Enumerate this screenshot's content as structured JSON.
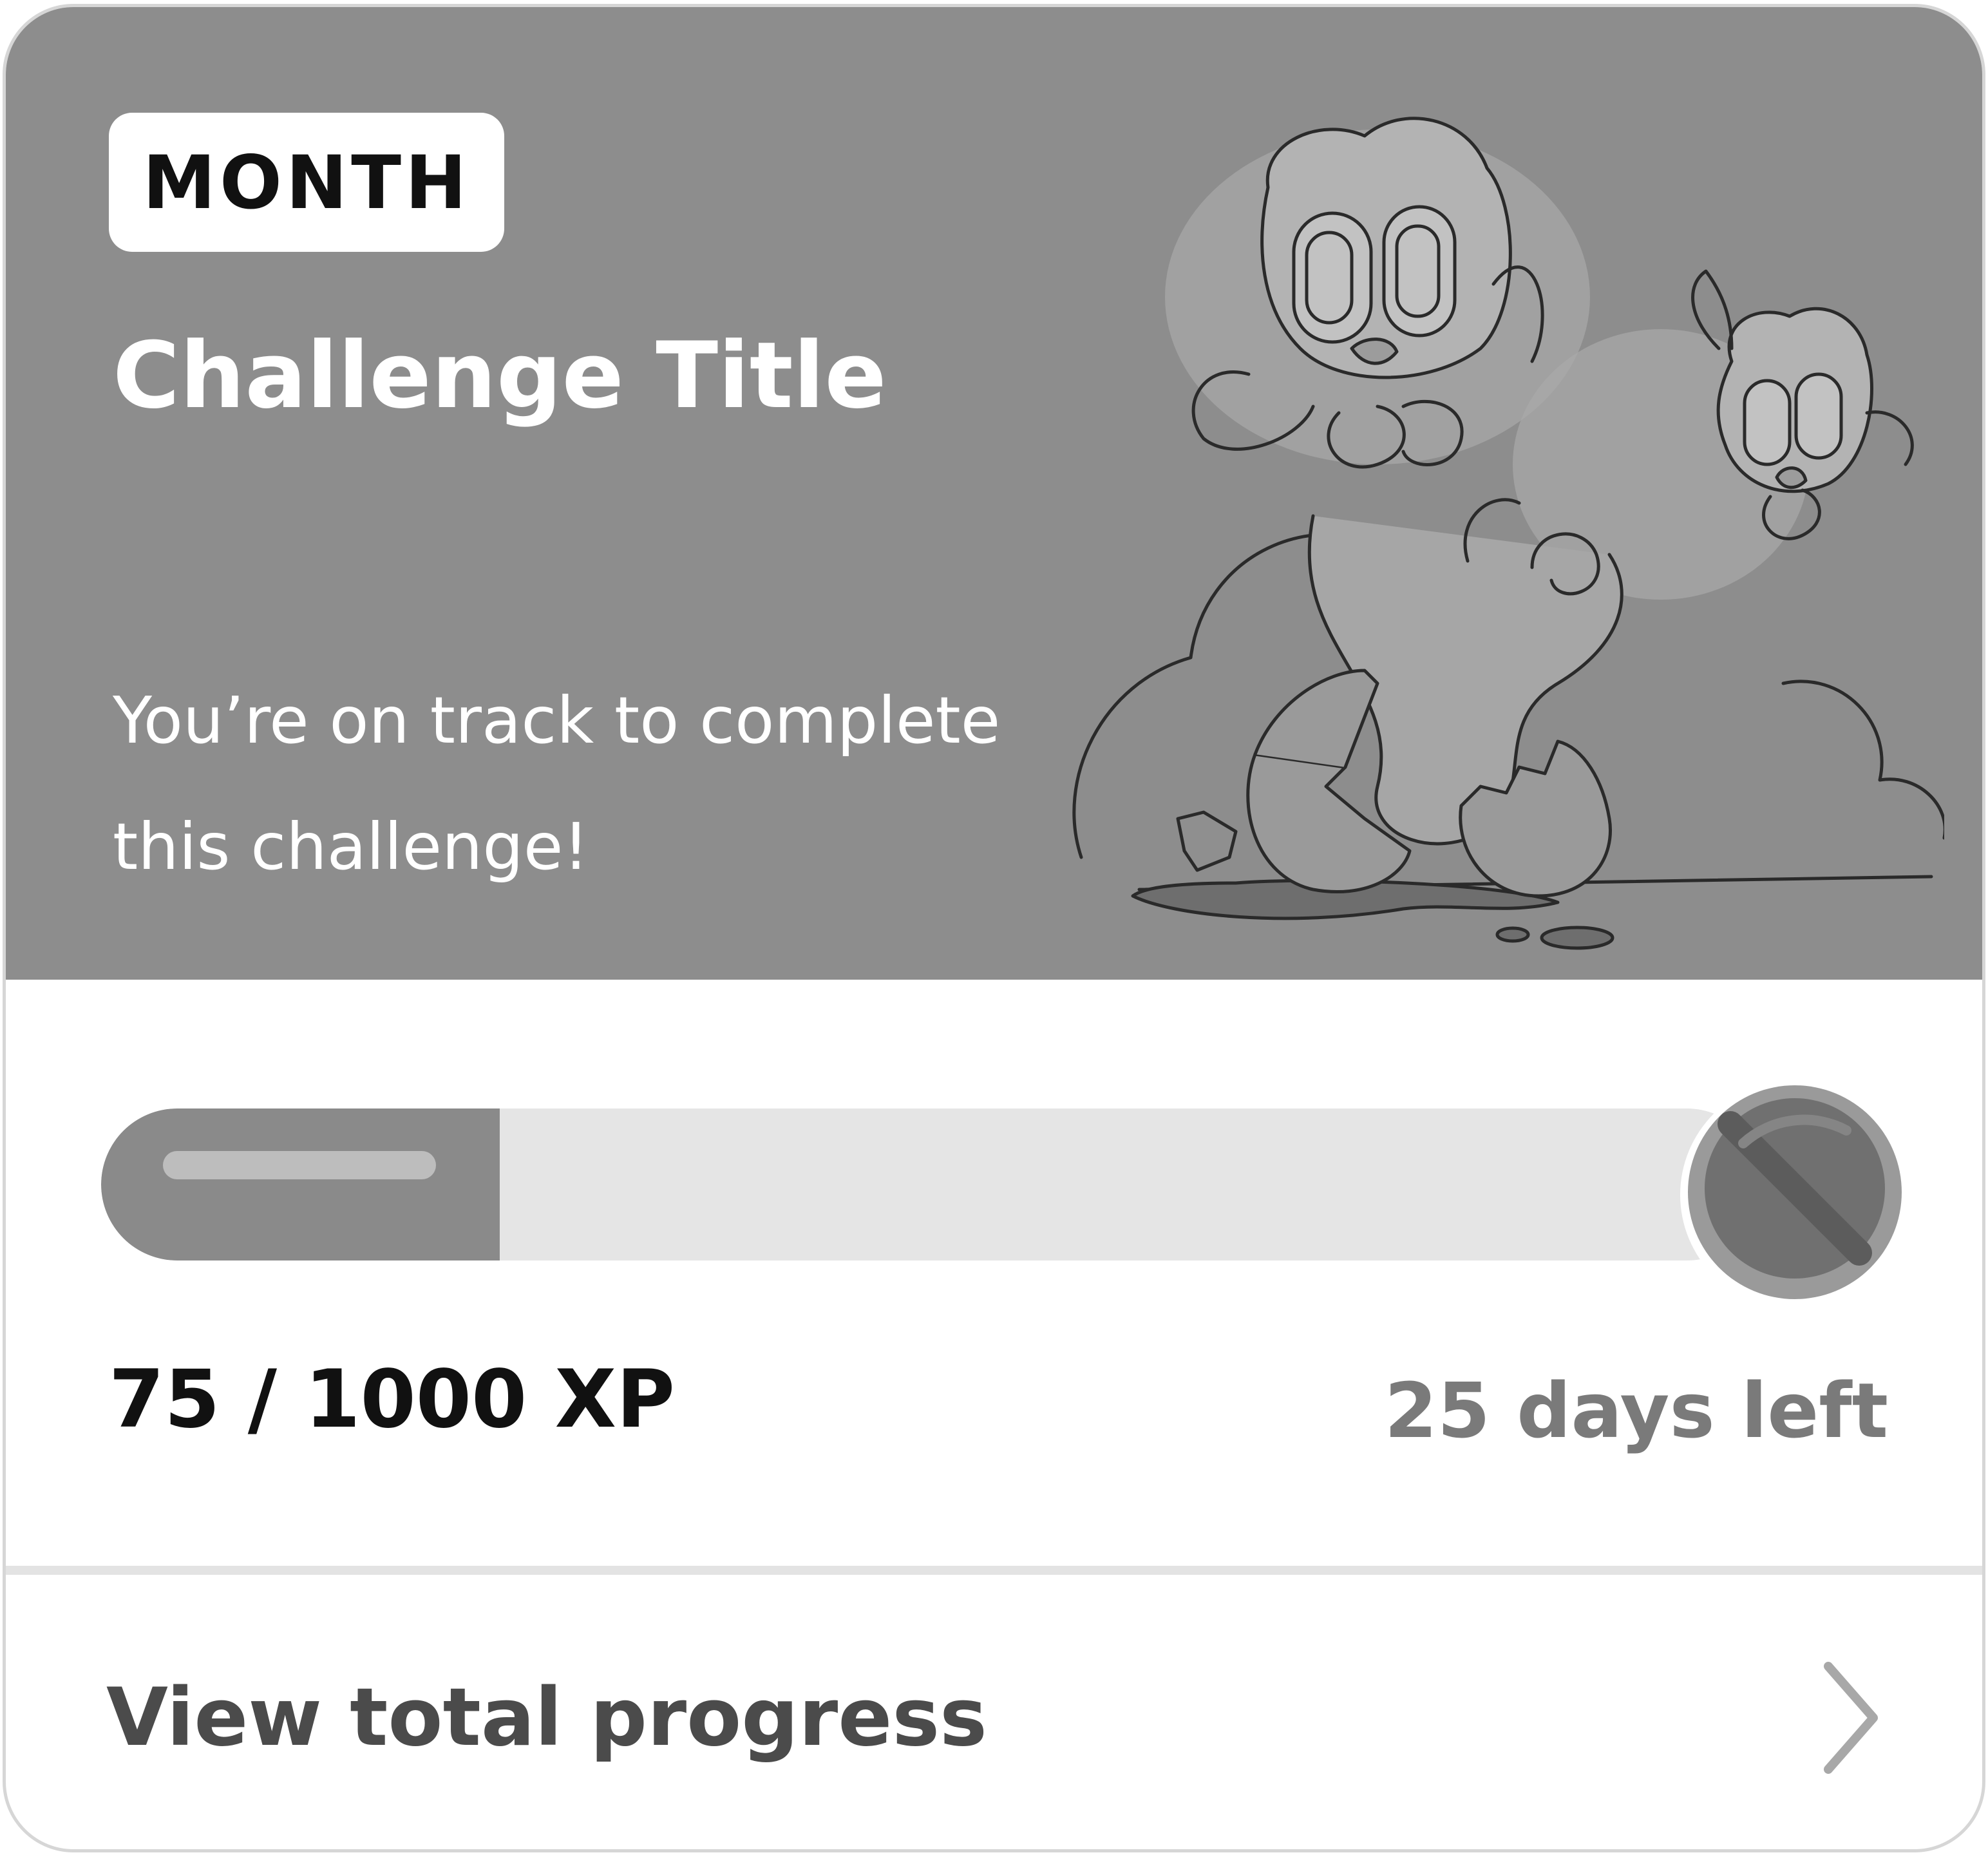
{
  "card": {
    "badge_label": "MONTH",
    "title": "Challenge Title",
    "subtitle": "You’re on track to complete this challenge!"
  },
  "progress": {
    "current_xp": 75,
    "goal_xp": 1000,
    "xp_label": "75 / 1000 XP",
    "days_left_label": "25 days left"
  },
  "footer": {
    "view_progress_label": "View total progress"
  },
  "icons": {
    "reward": "treasure-chest-icon",
    "chevron": "chevron-right-icon",
    "illustration": "hatching-mascots-illustration"
  },
  "colors": {
    "header_bg": "#8d8d8d",
    "progress_fill": "#8a8a8a",
    "progress_track": "#e5e5e5",
    "days_left": "#7a7a7a",
    "link_text": "#4b4b4b"
  }
}
